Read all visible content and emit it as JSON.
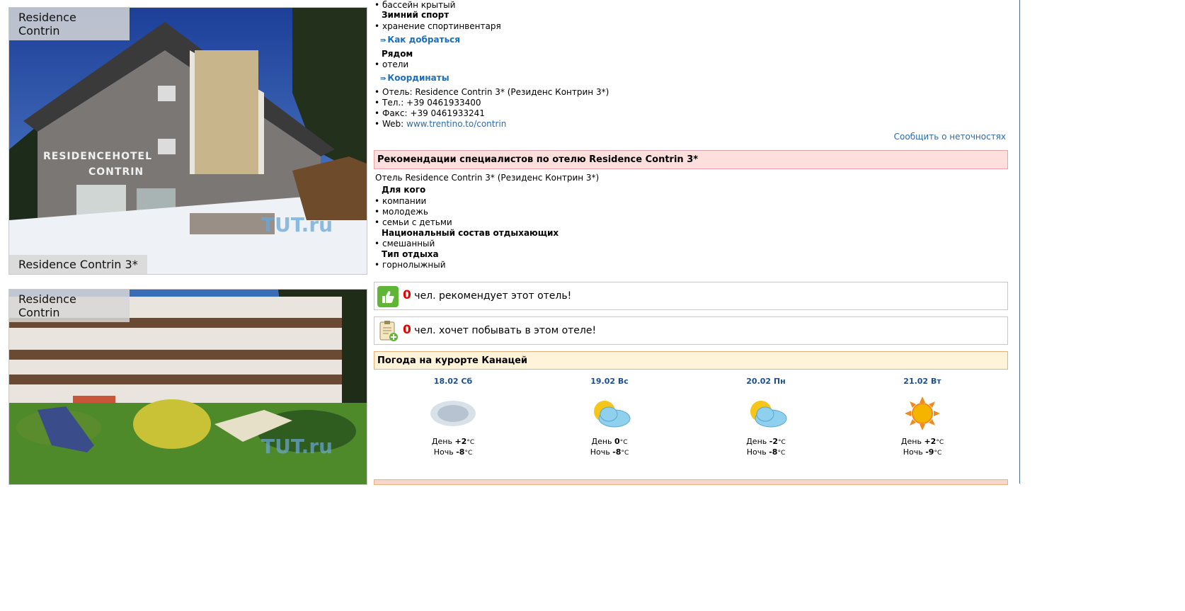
{
  "photos": [
    {
      "caption_top": "Residence Contrin",
      "caption_bottom": "Residence Contrin 3*",
      "building_text_1": "RESIDENCEHOTEL",
      "building_text_2": "CONTRIN",
      "watermark": "TUT.ru"
    },
    {
      "caption_top": "Residence Contrin",
      "watermark": "TUT.ru"
    }
  ],
  "info": {
    "pool_item": "бассейн крытый",
    "winter_heading": "Зимний спорт",
    "winter_item": "хранение спортинвентаря",
    "howto_link": "Как добраться",
    "nearby_heading": "Рядом",
    "nearby_item": "отели",
    "coords_link": "Координаты",
    "hotel_line": "Отель: Residence Contrin 3* (Резиденс Контрин 3*)",
    "phone_line": "Тел.: +39 0461933400",
    "fax_line": "Факс: +39 0461933241",
    "web_label": "Web: ",
    "web_url": "www.trentino.to/contrin",
    "report_link": "Сообщить о неточностях"
  },
  "recommend": {
    "title": "Рекомендации специалистов по отелю Residence Contrin 3*",
    "hotel_name": "Отель Residence Contrin 3* (Резиденс Контрин 3*)",
    "for_whom_heading": "Для кого",
    "for_whom": [
      "компании",
      "молодежь",
      "семьи с детьми"
    ],
    "nationality_heading": "Национальный состав отдыхающих",
    "nationality": [
      "смешанный"
    ],
    "rest_type_heading": "Тип отдыха",
    "rest_type": [
      "горнолыжный"
    ]
  },
  "votes": {
    "recommend_count": "0",
    "recommend_text": "чел. рекомендует этот отель!",
    "wish_count": "0",
    "wish_text": "чел. хочет побывать в этом отеле!"
  },
  "weather": {
    "title": "Погода на курорте Канацей",
    "day_label": "День",
    "night_label": "Ночь",
    "unit": "°C",
    "days": [
      {
        "date": "18.02 Сб",
        "icon": "blurred-icon",
        "day": "+2",
        "night": "-8"
      },
      {
        "date": "19.02 Вс",
        "icon": "sun-cloud-icon",
        "day": "0",
        "night": "-8"
      },
      {
        "date": "20.02 Пн",
        "icon": "sun-cloud-icon",
        "day": "-2",
        "night": "-8"
      },
      {
        "date": "21.02 Вт",
        "icon": "sun-icon",
        "day": "+2",
        "night": "-9"
      }
    ]
  },
  "colors": {
    "link": "#1b6fb9",
    "pink_box": "#ffdede",
    "beige_box": "#fff3da",
    "count": "#e60000"
  }
}
